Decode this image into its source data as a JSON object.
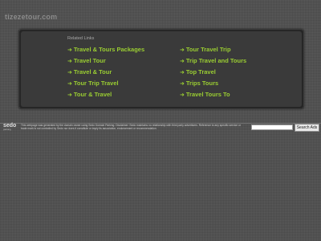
{
  "site": {
    "title": "tizezetour.com"
  },
  "related": {
    "heading": "Related Links",
    "arrow": "➜",
    "links_left": [
      "Travel & Tours Packages",
      "Travel Tour",
      "Travel & Tour",
      "Tour Trip Travel",
      "Tour & Travel"
    ],
    "links_right": [
      "Tour Travel Trip",
      "Trip Travel and Tours",
      "Top Travel",
      "Trips Tours",
      "Travel Tours To"
    ]
  },
  "footer": {
    "logo": "sedo",
    "logo_sub": "parking",
    "disclaimer": "This webpage was generated by the domain owner using Sedo Domain Parking. Disclaimer: Sedo maintains no relationship with third party advertisers. Reference to any specific service or trade mark is not controlled by Sedo nor does it constitute or imply its association, endorsement or recommendation.",
    "search_placeholder": "",
    "search_button": "Search Ads"
  },
  "colors": {
    "link": "#9acd32",
    "background": "#5a5a5a",
    "panel": "#3a3a3a"
  }
}
